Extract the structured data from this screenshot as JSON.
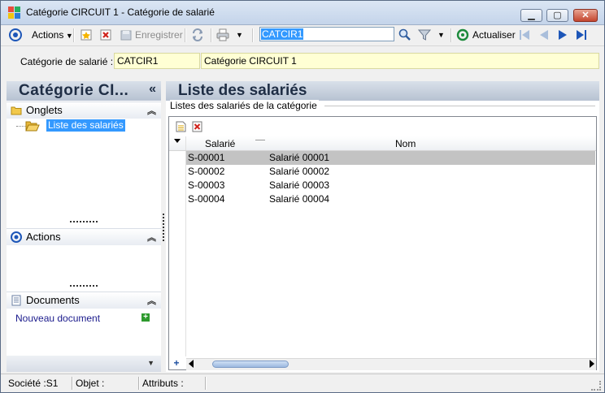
{
  "window": {
    "title": "Catégorie CIRCUIT 1 -  Catégorie de salarié",
    "minimize_glyph": "▁",
    "maximize_glyph": "▢",
    "close_glyph": "✕"
  },
  "toolbar": {
    "actions_label": "Actions",
    "save_label": "Enregistrer",
    "refresh_label": "Actualiser",
    "search_value": "CATCIR1"
  },
  "filter": {
    "label": "Catégorie de salarié :",
    "code": "CATCIR1",
    "description": "Catégorie CIRCUIT 1"
  },
  "left_panel": {
    "title": "Catégorie CI...",
    "collapse_glyph": "«",
    "sections": {
      "tabs": {
        "title": "Onglets",
        "items": [
          "Liste des salariés"
        ]
      },
      "actions": {
        "title": "Actions"
      },
      "documents": {
        "title": "Documents",
        "new_document": "Nouveau document"
      }
    }
  },
  "right_panel": {
    "title": "Liste des salariés",
    "group_label": "Listes des salariés de la catégorie",
    "columns": [
      "Salarié",
      "Nom"
    ],
    "rows": [
      {
        "code": "S-00001",
        "name": "Salarié 00001",
        "selected": true
      },
      {
        "code": "S-00002",
        "name": "Salarié 00002",
        "selected": false
      },
      {
        "code": "S-00003",
        "name": "Salarié 00003",
        "selected": false
      },
      {
        "code": "S-00004",
        "name": "Salarié 00004",
        "selected": false
      }
    ]
  },
  "status": {
    "company": "Société :S1",
    "object": "Objet :",
    "attributes": "Attributs :"
  },
  "colors": {
    "selection": "#3399ff",
    "panel_header": "#c4cedc",
    "field_highlight": "#ffffd4",
    "row_selected": "#c3c3c3"
  }
}
